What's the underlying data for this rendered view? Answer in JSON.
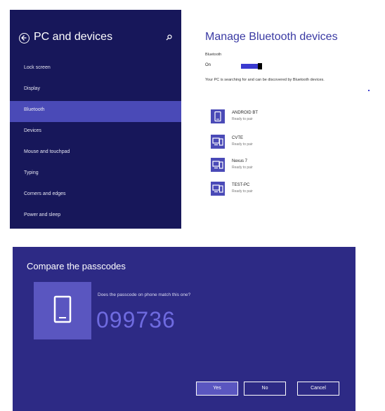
{
  "settings": {
    "panel_title": "PC and devices",
    "nav_items": [
      {
        "label": "Lock screen"
      },
      {
        "label": "Display"
      },
      {
        "label": "Bluetooth"
      },
      {
        "label": "Devices"
      },
      {
        "label": "Mouse and touchpad"
      },
      {
        "label": "Typing"
      },
      {
        "label": "Corners and edges"
      },
      {
        "label": "Power and sleep"
      }
    ],
    "selected_item": "Bluetooth",
    "main_title": "Manage Bluetooth devices",
    "bluetooth_label": "Bluetooth",
    "bluetooth_state": "On",
    "searching_text": "Your PC is searching for and can be discovered by Bluetooth devices.",
    "devices": [
      {
        "name": "ANDROID BT",
        "status": "Ready to pair",
        "icon": "phone-icon"
      },
      {
        "name": "CVTE",
        "status": "Ready to pair",
        "icon": "computer-icon"
      },
      {
        "name": "Nexus 7",
        "status": "Ready to pair",
        "icon": "computer-icon"
      },
      {
        "name": "TEST-PC",
        "status": "Ready to pair",
        "icon": "computer-icon"
      }
    ]
  },
  "dialog": {
    "title": "Compare the passcodes",
    "question": "Does the passcode on phone match this one?",
    "passcode": "099736",
    "buttons": {
      "yes": "Yes",
      "no": "No",
      "cancel": "Cancel"
    }
  },
  "colors": {
    "sidebar": "#17175a",
    "selected": "#4a4ab7",
    "dialog": "#2d2a85",
    "accent": "#3a3aa3"
  }
}
